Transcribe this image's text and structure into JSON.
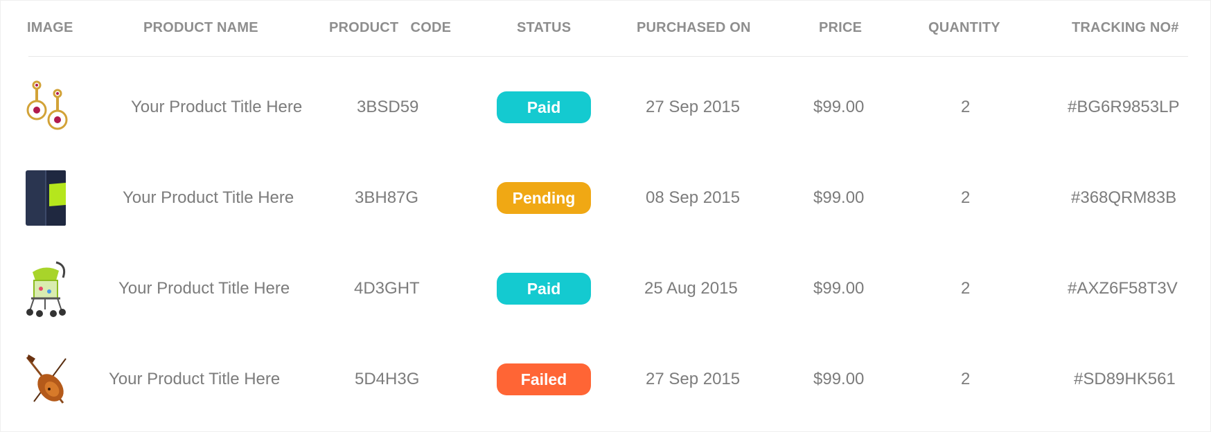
{
  "table": {
    "headers": {
      "image": "IMAGE",
      "product_name": "PRODUCT NAME",
      "product_code": "PRODUCT   CODE",
      "status": "STATUS",
      "purchased_on": "PURCHASED ON",
      "price": "PRICE",
      "quantity": "QUANTITY",
      "tracking": "TRACKING NO#"
    },
    "rows": [
      {
        "image_icon": "earrings-icon",
        "product_name": "Your Product Title Here",
        "product_code": "3BSD59",
        "status": "Paid",
        "status_color": "#14cad0",
        "purchased_on": "27 Sep 2015",
        "price": "$99.00",
        "quantity": "2",
        "tracking": "#BG6R9853LP"
      },
      {
        "image_icon": "phone-case-icon",
        "product_name": "Your Product Title Here",
        "product_code": "3BH87G",
        "status": "Pending",
        "status_color": "#f0a814",
        "purchased_on": "08 Sep 2015",
        "price": "$99.00",
        "quantity": "2",
        "tracking": "#368QRM83B"
      },
      {
        "image_icon": "stroller-icon",
        "product_name": "Your Product Title Here",
        "product_code": "4D3GHT",
        "status": "Paid",
        "status_color": "#14cad0",
        "purchased_on": "25 Aug 2015",
        "price": "$99.00",
        "quantity": "2",
        "tracking": "#AXZ6F58T3V"
      },
      {
        "image_icon": "violin-icon",
        "product_name": "Your Product Title Here",
        "product_code": "5D4H3G",
        "status": "Failed",
        "status_color": "#ff6535",
        "purchased_on": "27 Sep 2015",
        "price": "$99.00",
        "quantity": "2",
        "tracking": "#SD89HK561"
      }
    ]
  }
}
